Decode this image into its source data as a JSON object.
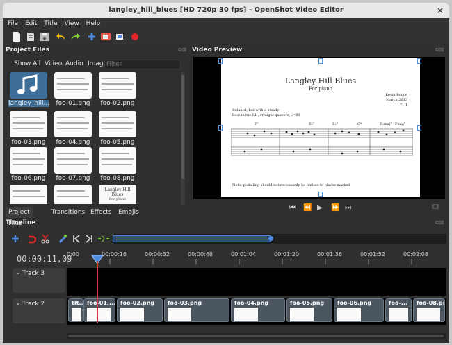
{
  "window": {
    "title": "langley_hill_blues [HD 720p 30 fps] - OpenShot Video Editor",
    "close": "×"
  },
  "menu": [
    "File",
    "Edit",
    "Title",
    "View",
    "Help"
  ],
  "project_files": {
    "title": "Project Files",
    "filters": [
      "Show All",
      "Video",
      "Audio",
      "Image"
    ],
    "filter_placeholder": "Filter",
    "items": [
      "langley_hill...",
      "foo-01.png",
      "foo-02.png",
      "foo-03.png",
      "foo-04.png",
      "foo-05.png",
      "foo-06.png",
      "foo-07.png",
      "foo-08.png"
    ],
    "partial_thumb_title": "Langley Hill Blues",
    "partial_thumb_sub": "For piano"
  },
  "bottom_tabs": [
    "Project Files",
    "Transitions",
    "Effects",
    "Emojis"
  ],
  "preview": {
    "title": "Video Preview",
    "sheet": {
      "title": "Langley Hill Blues",
      "subtitle": "For piano",
      "composer": "Kevin Boone",
      "date": "March 2013",
      "version": "v1.1",
      "tempo_line1": "Relaxed, but with a steady",
      "tempo_line2": "beat in the LH, straight quavers, ♩=80",
      "chord1": "F⁷",
      "chord2": "B♭⁷",
      "chord3": "E♭⁷",
      "chord4": "C⁹",
      "chord5": "E♭maj⁷",
      "chord6": "Fmaj⁷",
      "note": "Note: pedalling should not necessarily be limited to places marked"
    },
    "controls": [
      "⏮",
      "⏪",
      "▶",
      "⏩",
      "⏭"
    ]
  },
  "timeline": {
    "title": "Timeline",
    "timecode": "00:00:11,09",
    "ruler": [
      "0:00",
      "00:00:16",
      "00:00:32",
      "00:00:48",
      "00:01:04",
      "00:01:20",
      "00:01:36",
      "00:01:52",
      "00:02:08"
    ],
    "tracks": [
      {
        "name": "Track 3",
        "clips": []
      },
      {
        "name": "Track 2",
        "clips": [
          "tit...",
          "foo-01....",
          "foo-02.png",
          "foo-03.png",
          "foo-04.png",
          "foo-05.png",
          "foo-06.png",
          "foo-...",
          "foo-08.pn"
        ]
      }
    ]
  }
}
